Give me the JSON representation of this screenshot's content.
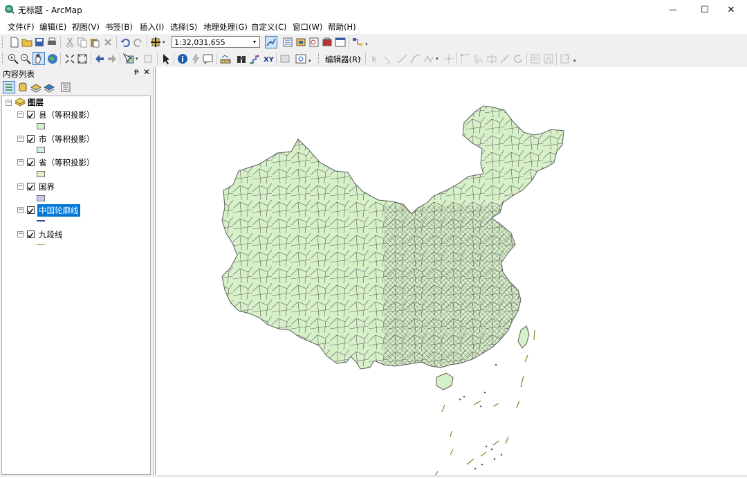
{
  "window": {
    "title": "无标题 - ArcMap",
    "minimize_glyph": "—",
    "maximize_glyph": "☐",
    "close_glyph": "✕"
  },
  "menubar": {
    "items": [
      {
        "label": "文件(F)"
      },
      {
        "label": "编辑(E)"
      },
      {
        "label": "视图(V)"
      },
      {
        "label": "书签(B)"
      },
      {
        "label": "插入(I)"
      },
      {
        "label": "选择(S)"
      },
      {
        "label": "地理处理(G)"
      },
      {
        "label": "自定义(C)"
      },
      {
        "label": "窗口(W)"
      },
      {
        "label": "帮助(H)"
      }
    ]
  },
  "toolbar": {
    "scale_value": "1:32,031,655",
    "editor_label": "编辑器(R)",
    "dropdown_glyph": "▾"
  },
  "toc": {
    "title": "内容列表",
    "pin_glyph": "ᵽ",
    "close_glyph": "✕",
    "root_label": "图层",
    "layers": [
      {
        "label": "县（等积投影）",
        "checked": true,
        "symbol": "polygon",
        "fill": "#d4f0c8"
      },
      {
        "label": "市（等积投影）",
        "checked": true,
        "symbol": "polygon",
        "fill": "#d2f2e6"
      },
      {
        "label": "省（等积投影）",
        "checked": true,
        "symbol": "polygon",
        "fill": "#e6f0c0"
      },
      {
        "label": "国界",
        "checked": true,
        "symbol": "polygon",
        "fill": "#c8c8f0"
      },
      {
        "label": "中国轮廓线",
        "checked": true,
        "symbol": "line",
        "fill": "#2a4f8a",
        "selected": true
      },
      {
        "label": "九段线",
        "checked": true,
        "symbol": "line",
        "fill": "#9c9c3a"
      }
    ]
  },
  "map": {
    "fill_color": "#d6f0c8",
    "boundary_color": "#5a5a5a",
    "nine_dash_color": "#7a8a2a"
  }
}
